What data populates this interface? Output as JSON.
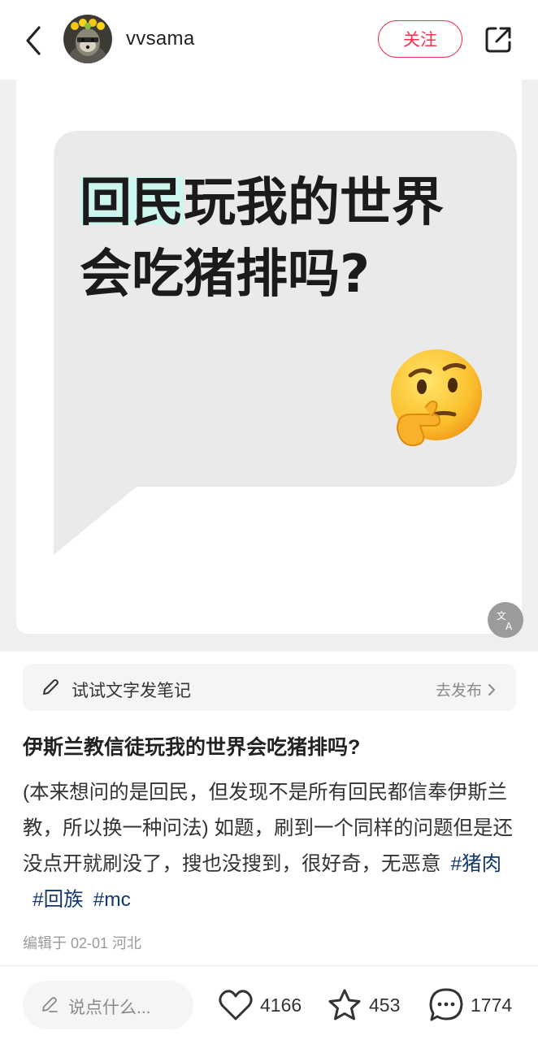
{
  "header": {
    "username": "vvsama",
    "follow_label": "关注"
  },
  "image": {
    "line1_highlight": "回民",
    "line1_rest": "玩我的世界",
    "line2": "会吃猪排吗?",
    "emoji": "thinking-face"
  },
  "try_note": {
    "label": "试试文字发笔记",
    "action": "去发布"
  },
  "post": {
    "title": "伊斯兰教信徒玩我的世界会吃猪排吗?",
    "body": "(本来想问的是回民，但发现不是所有回民都信奉伊斯兰教，所以换一种问法) 如题，刷到一个同样的问题但是还没点开就刷没了，搜也没搜到，很好奇，无恶意",
    "tags": [
      "#猪肉",
      "#回族",
      "#mc"
    ],
    "meta": "编辑于 02-01 河北"
  },
  "bottom_bar": {
    "comment_placeholder": "说点什么...",
    "likes": "4166",
    "collects": "453",
    "comments": "1774"
  },
  "colors": {
    "accent": "#ff2e4d",
    "tag": "#13386c",
    "highlight": "#cdf6ef"
  }
}
